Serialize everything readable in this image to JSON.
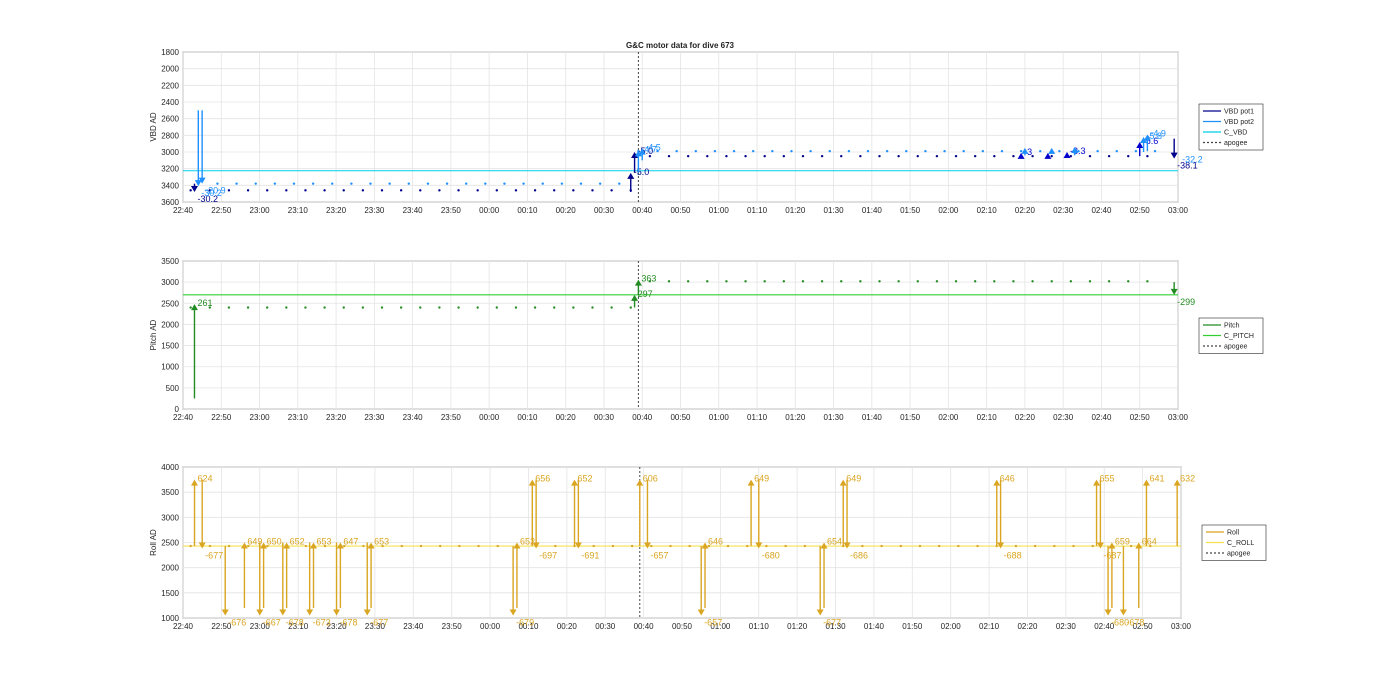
{
  "figure_title": "G&C motor data for dive 673",
  "chart_data": [
    {
      "type": "line",
      "ylabel": "VBD AD",
      "ylim": [
        1800,
        3600
      ],
      "y_reversed": true,
      "yticks": [
        1800,
        2000,
        2200,
        2400,
        2600,
        2800,
        3000,
        3200,
        3400,
        3600
      ],
      "x_ticks": [
        "22:40",
        "22:50",
        "23:00",
        "23:10",
        "23:20",
        "23:30",
        "23:40",
        "23:50",
        "00:00",
        "00:10",
        "00:20",
        "00:30",
        "00:40",
        "00:50",
        "01:00",
        "01:10",
        "01:20",
        "01:30",
        "01:40",
        "01:50",
        "02:00",
        "02:10",
        "02:20",
        "02:30",
        "02:40",
        "02:50",
        "03:00"
      ],
      "apogee_time": "00:39",
      "legend": [
        "VBD pot1",
        "VBD pot2",
        "C_VBD",
        "apogee"
      ],
      "colors": {
        "pot1": "#00008b",
        "pot2": "#1e90ff",
        "cmd": "#00cfe8",
        "apogee": "#444444"
      },
      "series": [
        {
          "name": "VBD pot1",
          "level_before": 3460,
          "level_after": 3050
        },
        {
          "name": "VBD pot2",
          "level_before": 3380,
          "level_after": 2990
        },
        {
          "name": "C_VBD",
          "x": [
            "22:40",
            "03:00"
          ],
          "values": [
            3225,
            3225
          ]
        }
      ],
      "moves": [
        {
          "t": "22:43",
          "from": 3380,
          "to": 3480,
          "label": "-30.2",
          "color": "#00008b"
        },
        {
          "t": "22:44",
          "from": 2500,
          "to": 3410,
          "label": "-30.2",
          "color": "#1e90ff"
        },
        {
          "t": "22:45",
          "from": 2500,
          "to": 3380,
          "label": "-20.9",
          "color": "#1e90ff"
        },
        {
          "t": "00:37",
          "from": 3480,
          "to": 3250,
          "label": "-5.0",
          "color": "#00008b"
        },
        {
          "t": "00:38",
          "from": 3250,
          "to": 3000,
          "label": "-5.0",
          "color": "#00008b"
        },
        {
          "t": "00:39",
          "from": 3250,
          "to": 2980,
          "label": "-4.7",
          "color": "#1e90ff"
        },
        {
          "t": "00:40",
          "from": 3100,
          "to": 2960,
          "label": "-4.5",
          "color": "#1e90ff"
        },
        {
          "t": "02:19",
          "from": 3060,
          "to": 3010,
          "label": "-3",
          "color": "#0000cd"
        },
        {
          "t": "02:20",
          "from": 3040,
          "to": 2950,
          "label": "",
          "color": "#1e90ff"
        },
        {
          "t": "02:26",
          "from": 3050,
          "to": 3010,
          "label": "",
          "color": "#0000cd"
        },
        {
          "t": "02:27",
          "from": 3020,
          "to": 2950,
          "label": "",
          "color": "#1e90ff"
        },
        {
          "t": "02:31",
          "from": 3060,
          "to": 3000,
          "label": "-3.3",
          "color": "#0000cd"
        },
        {
          "t": "02:33",
          "from": 3040,
          "to": 2940,
          "label": "",
          "color": "#1e90ff"
        },
        {
          "t": "02:50",
          "from": 3050,
          "to": 2880,
          "label": "-5.6",
          "color": "#0000cd"
        },
        {
          "t": "02:51",
          "from": 3000,
          "to": 2820,
          "label": "-5.8",
          "color": "#1e90ff"
        },
        {
          "t": "02:52",
          "from": 2990,
          "to": 2790,
          "label": "-4.9",
          "color": "#1e90ff"
        },
        {
          "t": "02:59",
          "from": 2840,
          "to": 3080,
          "label": "-38.1",
          "color": "#00008b"
        }
      ],
      "extra_labels": [
        {
          "t": "02:59",
          "y": 3080,
          "text": "-32.2",
          "color": "#1e90ff"
        }
      ]
    },
    {
      "type": "line",
      "ylabel": "Pitch AD",
      "ylim": [
        0,
        3500
      ],
      "y_reversed": false,
      "yticks": [
        0,
        500,
        1000,
        1500,
        2000,
        2500,
        3000,
        3500
      ],
      "x_ticks": [
        "22:40",
        "22:50",
        "23:00",
        "23:10",
        "23:20",
        "23:30",
        "23:40",
        "23:50",
        "00:00",
        "00:10",
        "00:20",
        "00:30",
        "00:40",
        "00:50",
        "01:00",
        "01:10",
        "01:20",
        "01:30",
        "01:40",
        "01:50",
        "02:00",
        "02:10",
        "02:20",
        "02:30",
        "02:40",
        "02:50",
        "03:00"
      ],
      "apogee_time": "00:39",
      "legend": [
        "Pitch",
        "C_PITCH",
        "apogee"
      ],
      "colors": {
        "pot": "#228b22",
        "cmd": "#32cd32",
        "apogee": "#444444"
      },
      "series": [
        {
          "name": "Pitch",
          "level_before": 2400,
          "level_after": 3020
        },
        {
          "name": "C_PITCH",
          "x": [
            "22:40",
            "03:00"
          ],
          "values": [
            2700,
            2700
          ]
        }
      ],
      "moves": [
        {
          "t": "22:43",
          "from": 250,
          "to": 2480,
          "label": "261",
          "color": "#228b22"
        },
        {
          "t": "00:38",
          "from": 2400,
          "to": 2700,
          "label": "297",
          "color": "#228b22"
        },
        {
          "t": "00:39",
          "from": 2700,
          "to": 3060,
          "label": "363",
          "color": "#228b22"
        },
        {
          "t": "02:59",
          "from": 3000,
          "to": 2700,
          "label": "-299",
          "color": "#228b22"
        }
      ],
      "extra_labels": []
    },
    {
      "type": "line",
      "ylabel": "Roll AD",
      "ylim": [
        1000,
        4000
      ],
      "y_reversed": false,
      "yticks": [
        1000,
        1500,
        2000,
        2500,
        3000,
        3500,
        4000
      ],
      "x_ticks": [
        "22:40",
        "22:50",
        "23:00",
        "23:10",
        "23:20",
        "23:30",
        "23:40",
        "23:50",
        "00:00",
        "00:10",
        "00:20",
        "00:30",
        "00:40",
        "00:50",
        "01:00",
        "01:10",
        "01:20",
        "01:30",
        "01:40",
        "01:50",
        "02:00",
        "02:10",
        "02:20",
        "02:30",
        "02:40",
        "02:50",
        "03:00"
      ],
      "apogee_time": "00:39",
      "legend": [
        "Roll",
        "C_ROLL",
        "apogee"
      ],
      "colors": {
        "pot": "#daa520",
        "cmd": "#f5e050",
        "apogee": "#444444"
      },
      "series": [
        {
          "name": "Roll",
          "level_before": 2430,
          "level_after": 2430
        },
        {
          "name": "C_ROLL",
          "x": [
            "22:40",
            "03:00"
          ],
          "values": [
            2430,
            2430
          ]
        }
      ],
      "moves": [
        {
          "t": "22:43",
          "from": 2430,
          "to": 3750,
          "label": "624",
          "color": "#daa520"
        },
        {
          "t": "22:45",
          "from": 3750,
          "to": 2380,
          "label": "-677",
          "color": "#daa520"
        },
        {
          "t": "22:51",
          "from": 2430,
          "to": 1050,
          "label": "-676",
          "color": "#daa520"
        },
        {
          "t": "22:56",
          "from": 1200,
          "to": 2500,
          "label": "649",
          "color": "#daa520"
        },
        {
          "t": "23:00",
          "from": 2500,
          "to": 1050,
          "label": "-667",
          "color": "#daa520"
        },
        {
          "t": "23:01",
          "from": 1200,
          "to": 2500,
          "label": "650",
          "color": "#daa520"
        },
        {
          "t": "23:06",
          "from": 2500,
          "to": 1050,
          "label": "-678",
          "color": "#daa520"
        },
        {
          "t": "23:07",
          "from": 1200,
          "to": 2500,
          "label": "652",
          "color": "#daa520"
        },
        {
          "t": "23:13",
          "from": 2500,
          "to": 1050,
          "label": "-673",
          "color": "#daa520"
        },
        {
          "t": "23:14",
          "from": 1200,
          "to": 2500,
          "label": "653",
          "color": "#daa520"
        },
        {
          "t": "23:20",
          "from": 2500,
          "to": 1050,
          "label": "-678",
          "color": "#daa520"
        },
        {
          "t": "23:21",
          "from": 1200,
          "to": 2500,
          "label": "647",
          "color": "#daa520"
        },
        {
          "t": "23:28",
          "from": 2500,
          "to": 1050,
          "label": "-677",
          "color": "#daa520"
        },
        {
          "t": "23:29",
          "from": 1200,
          "to": 2500,
          "label": "653",
          "color": "#daa520"
        },
        {
          "t": "00:06",
          "from": 2430,
          "to": 1050,
          "label": "-679",
          "color": "#daa520"
        },
        {
          "t": "00:07",
          "from": 1200,
          "to": 2500,
          "label": "652",
          "color": "#daa520"
        },
        {
          "t": "00:11",
          "from": 2430,
          "to": 3750,
          "label": "656",
          "color": "#daa520"
        },
        {
          "t": "00:12",
          "from": 3750,
          "to": 2380,
          "label": "-697",
          "color": "#daa520"
        },
        {
          "t": "00:22",
          "from": 2430,
          "to": 3750,
          "label": "652",
          "color": "#daa520"
        },
        {
          "t": "00:23",
          "from": 3750,
          "to": 2380,
          "label": "-691",
          "color": "#daa520"
        },
        {
          "t": "00:39",
          "from": 2430,
          "to": 3750,
          "label": "606",
          "color": "#daa520"
        },
        {
          "t": "00:41",
          "from": 3750,
          "to": 2380,
          "label": "-657",
          "color": "#daa520"
        },
        {
          "t": "00:55",
          "from": 2430,
          "to": 1050,
          "label": "-657",
          "color": "#daa520"
        },
        {
          "t": "00:56",
          "from": 1200,
          "to": 2500,
          "label": "646",
          "color": "#daa520"
        },
        {
          "t": "01:08",
          "from": 2430,
          "to": 3750,
          "label": "649",
          "color": "#daa520"
        },
        {
          "t": "01:10",
          "from": 3750,
          "to": 2380,
          "label": "-680",
          "color": "#daa520"
        },
        {
          "t": "01:26",
          "from": 2430,
          "to": 1050,
          "label": "-677",
          "color": "#daa520"
        },
        {
          "t": "01:27",
          "from": 1200,
          "to": 2500,
          "label": "654",
          "color": "#daa520"
        },
        {
          "t": "01:32",
          "from": 2430,
          "to": 3750,
          "label": "649",
          "color": "#daa520"
        },
        {
          "t": "01:33",
          "from": 3750,
          "to": 2380,
          "label": "-686",
          "color": "#daa520"
        },
        {
          "t": "02:12",
          "from": 2430,
          "to": 3750,
          "label": "646",
          "color": "#daa520"
        },
        {
          "t": "02:13",
          "from": 3750,
          "to": 2380,
          "label": "-688",
          "color": "#daa520"
        },
        {
          "t": "02:38",
          "from": 2430,
          "to": 3750,
          "label": "655",
          "color": "#daa520"
        },
        {
          "t": "02:39",
          "from": 3750,
          "to": 2380,
          "label": "-687",
          "color": "#daa520"
        },
        {
          "t": "02:41",
          "from": 2430,
          "to": 1050,
          "label": "-680",
          "color": "#daa520"
        },
        {
          "t": "02:42",
          "from": 1200,
          "to": 2500,
          "label": "659",
          "color": "#daa520"
        },
        {
          "t": "02:45",
          "from": 2430,
          "to": 1050,
          "label": "-678",
          "color": "#daa520"
        },
        {
          "t": "02:49",
          "from": 1200,
          "to": 2500,
          "label": "664",
          "color": "#daa520"
        },
        {
          "t": "02:51",
          "from": 2430,
          "to": 3750,
          "label": "641",
          "color": "#daa520"
        },
        {
          "t": "02:59",
          "from": 2430,
          "to": 3750,
          "label": "632",
          "color": "#daa520"
        }
      ],
      "extra_labels": []
    }
  ]
}
